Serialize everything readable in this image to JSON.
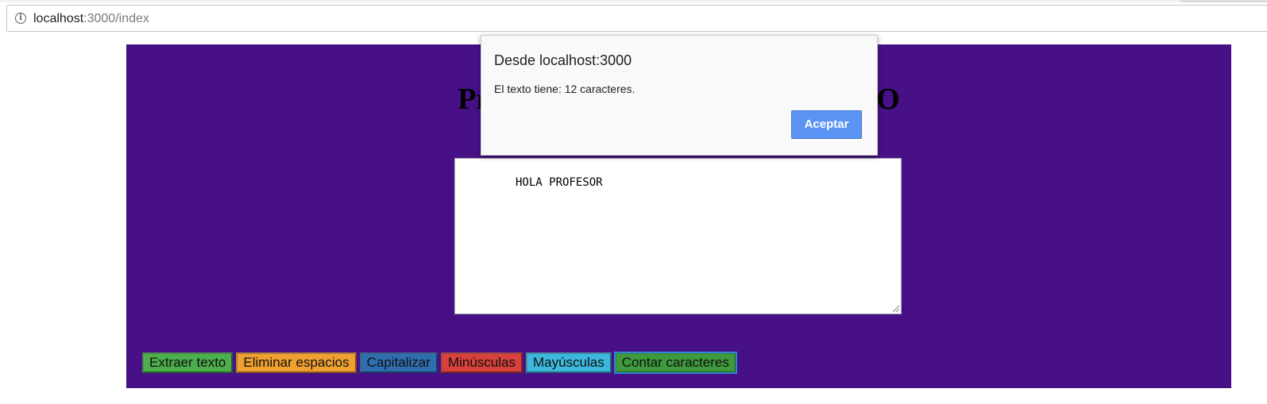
{
  "browser": {
    "url_host": "localhost",
    "url_path": ":3000/index"
  },
  "page": {
    "title": "Proc                                          LDO",
    "textarea_value": "HOLA PROFESOR",
    "buttons": [
      {
        "label": "Extraer texto",
        "color": "#4cae4c"
      },
      {
        "label": "Eliminar espacios",
        "color": "#f0a030"
      },
      {
        "label": "Capitalizar",
        "color": "#2f6fb0"
      },
      {
        "label": "Minúsculas",
        "color": "#d9413c"
      },
      {
        "label": "Mayúsculas",
        "color": "#3db8dd"
      },
      {
        "label": "Contar caracteres",
        "color": "#3d9a3d"
      }
    ],
    "background_color": "#471087"
  },
  "alert": {
    "title": "Desde localhost:3000",
    "message": "El texto tiene: 12 caracteres.",
    "ok_label": "Aceptar"
  }
}
